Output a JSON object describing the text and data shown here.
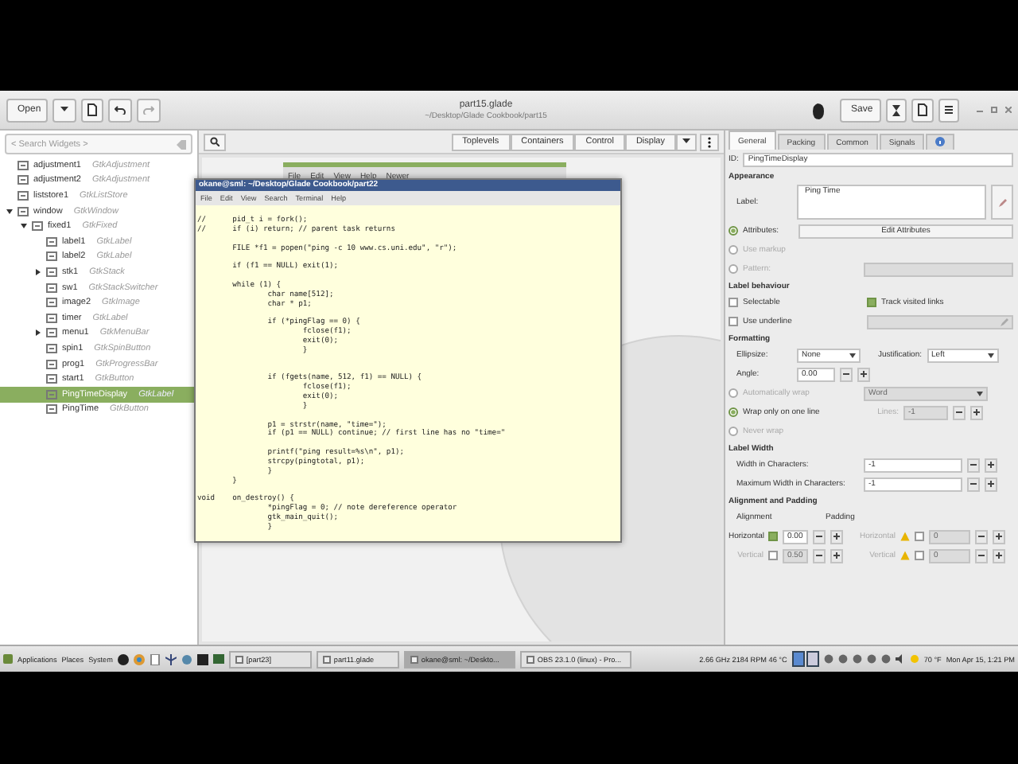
{
  "header": {
    "open_button": "Open",
    "redo": {
      "disabled": true
    },
    "title": "part15.glade",
    "subtitle": "~/Desktop/Glade Cookbook/part15",
    "save_button": "Save"
  },
  "widget_tree": {
    "search": {
      "placeholder": "< Search Widgets >"
    },
    "items": [
      {
        "name": "adjustment1",
        "type": "GtkAdjustment",
        "selected": false
      },
      {
        "name": "adjustment2",
        "type": "GtkAdjustment",
        "selected": false
      },
      {
        "name": "liststore1",
        "type": "GtkListStore",
        "selected": false
      },
      {
        "name": "window",
        "type": "GtkWindow",
        "selected": false,
        "expanded": true,
        "children": [
          {
            "name": "fixed1",
            "type": "GtkFixed",
            "selected": false,
            "expanded": true,
            "children": [
              {
                "name": "label1",
                "type": "GtkLabel",
                "selected": false
              },
              {
                "name": "label2",
                "type": "GtkLabel",
                "selected": false
              },
              {
                "name": "stk1",
                "type": "GtkStack",
                "selected": false,
                "expanded": false
              },
              {
                "name": "sw1",
                "type": "GtkStackSwitcher",
                "selected": false
              },
              {
                "name": "image2",
                "type": "GtkImage",
                "selected": false
              },
              {
                "name": "timer",
                "type": "GtkLabel",
                "selected": false
              },
              {
                "name": "menu1",
                "type": "GtkMenuBar",
                "selected": false,
                "expanded": false
              },
              {
                "name": "spin1",
                "type": "GtkSpinButton",
                "selected": false
              },
              {
                "name": "prog1",
                "type": "GtkProgressBar",
                "selected": false
              },
              {
                "name": "start1",
                "type": "GtkButton",
                "selected": false
              },
              {
                "name": "PingTimeDisplay",
                "type": "GtkLabel",
                "selected": true
              },
              {
                "name": "PingTime",
                "type": "GtkButton",
                "selected": false
              }
            ]
          }
        ]
      }
    ]
  },
  "palette": {
    "groups": [
      "Toplevels",
      "Containers",
      "Control",
      "Display"
    ]
  },
  "preview": {
    "menu": [
      "File",
      "Edit",
      "View",
      "Help",
      "Newer"
    ]
  },
  "terminal": {
    "title": "okane@sml: ~/Desktop/Glade Cookbook/part22",
    "menu": [
      "File",
      "Edit",
      "View",
      "Search",
      "Terminal",
      "Help"
    ],
    "blocks": [
      {
        "lines": [
          "//      pid_t i = fork();",
          "//      if (i) return; // parent task returns"
        ]
      },
      {
        "lines": [
          "        FILE *f1 = popen(\"ping -c 10 www.cs.uni.edu\", \"r\");"
        ]
      },
      {
        "lines": [
          "        if (f1 == NULL) exit(1);"
        ]
      },
      {
        "lines": [
          "        while (1) {",
          "                char name[512];",
          "                char * p1;"
        ]
      },
      {
        "lines": [
          "                if (*pingFlag == 0) {",
          "                        fclose(f1);",
          "                        exit(0);",
          "                        }"
        ]
      },
      {
        "extra_blank_line": true,
        "lines": [
          "                if (fgets(name, 512, f1) == NULL) {",
          "                        fclose(f1);",
          "                        exit(0);",
          "                        }"
        ]
      },
      {
        "lines": [
          "                p1 = strstr(name, \"time=\");",
          "                if (p1 == NULL) continue; // first line has no \"time=\""
        ]
      },
      {
        "lines": [
          "                printf(\"ping result=%s\\n\", p1);",
          "                strcpy(pingtotal, p1);",
          "                }",
          "        }"
        ]
      },
      {
        "lines": [
          "void    on_destroy() {",
          "                *pingFlag = 0; // note dereference operator",
          "                gtk_main_quit();",
          "                }"
        ]
      }
    ]
  },
  "properties": {
    "tabs": [
      {
        "label": "General",
        "selected": true
      },
      {
        "label": "Packing",
        "selected": false
      },
      {
        "label": "Common",
        "selected": false
      },
      {
        "label": "Signals",
        "selected": false
      }
    ],
    "id_label": "ID:",
    "id_value": "PingTimeDisplay",
    "sections": [
      {
        "title": "Appearance",
        "rows": [
          {
            "kind": "textarea",
            "label": "Label:",
            "value": "Ping Time"
          },
          {
            "kind": "radio-button",
            "label": "Attributes:",
            "selected": true,
            "button": "Edit Attributes"
          },
          {
            "kind": "radio",
            "label": "Use markup",
            "selected": false
          },
          {
            "kind": "radio-field",
            "label": "Pattern:",
            "selected": false
          }
        ]
      },
      {
        "title": "Label behaviour",
        "rows": [
          {
            "kind": "check-pair",
            "items": [
              {
                "label": "Selectable",
                "checked": false
              },
              {
                "label": "Track visited links",
                "checked": true
              }
            ]
          },
          {
            "kind": "check-field",
            "label": "Use underline",
            "checked": false
          }
        ]
      },
      {
        "title": "Formatting",
        "rows": [
          {
            "kind": "combo-pair",
            "label": "Ellipsize:",
            "value": "None",
            "label2": "Justification:",
            "value2": "Left"
          },
          {
            "kind": "spin",
            "label": "Angle:",
            "value": "0.00"
          },
          {
            "kind": "radio-combo",
            "label": "Automatically wrap",
            "selected": false,
            "value": "Word"
          },
          {
            "kind": "radio-spin",
            "label": "Wrap only on one line",
            "selected": true,
            "spin_label": "Lines:",
            "value": "-1"
          },
          {
            "kind": "radio",
            "label": "Never wrap",
            "selected": false
          }
        ]
      },
      {
        "title": "Label Width",
        "rows": [
          {
            "kind": "wide-spin",
            "label": "Width in Characters:",
            "value": "-1"
          },
          {
            "kind": "wide-spin",
            "label": "Maximum Width in Characters:",
            "value": "-1"
          }
        ]
      },
      {
        "title": "Alignment and Padding",
        "rows": [
          {
            "kind": "headers",
            "a": "Alignment",
            "b": "Padding"
          },
          {
            "kind": "align",
            "label": "Horizontal",
            "checked": true,
            "value": "0.00",
            "pad_label": "Horizontal",
            "pad_checked": false,
            "pad_value": "0"
          },
          {
            "kind": "align",
            "label": "Vertical",
            "checked": false,
            "value": "0.50",
            "pad_label": "Vertical",
            "pad_checked": false,
            "pad_value": "0"
          }
        ]
      }
    ]
  },
  "taskbar": {
    "menus": [
      "Applications",
      "Places",
      "System"
    ],
    "tasks": [
      {
        "label": "[part23]",
        "selected": false
      },
      {
        "label": "part11.glade",
        "selected": false
      },
      {
        "label": "okane@sml: ~/Deskto...",
        "selected": true
      },
      {
        "label": "OBS 23.1.0 (linux) - Pro...",
        "selected": false
      }
    ],
    "cpu": "2.66 GHz 2184 RPM 46 °C",
    "weather": "70 °F",
    "clock": "Mon Apr 15,  1:21 PM"
  }
}
